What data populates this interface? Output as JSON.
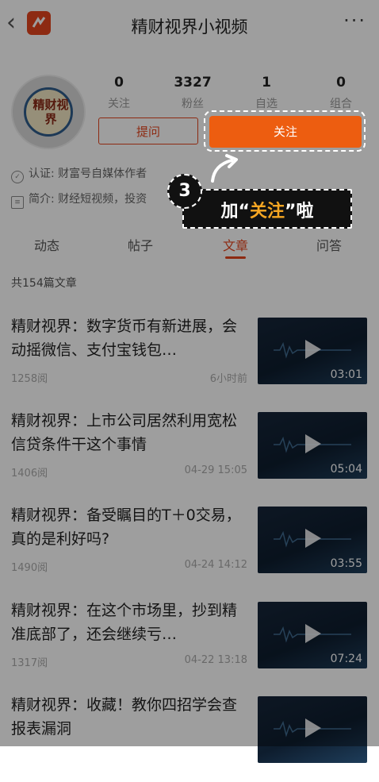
{
  "header": {
    "title": "精财视界小视频",
    "back_icon": "chevron-left-icon",
    "more_icon": "more-icon"
  },
  "profile": {
    "avatar_text": "精财视界",
    "stats": [
      {
        "value": "0",
        "label": "关注"
      },
      {
        "value": "3327",
        "label": "粉丝"
      },
      {
        "value": "1",
        "label": "自选"
      },
      {
        "value": "0",
        "label": "组合"
      }
    ],
    "ask_label": "提问",
    "follow_label": "关注",
    "certification": "认证: 财富号自媒体作者",
    "intro": "简介: 财经短视频，投资"
  },
  "tabs": [
    {
      "label": "动态"
    },
    {
      "label": "帖子"
    },
    {
      "label": "文章",
      "active": true
    },
    {
      "label": "问答"
    }
  ],
  "article_count": "共154篇文章",
  "articles": [
    {
      "title": "精财视界：数字货币有新进展，会动摇微信、支付宝钱包…",
      "reads": "1258阅",
      "time": "6小时前",
      "duration": "03:01"
    },
    {
      "title": "精财视界：上市公司居然利用宽松信贷条件干这个事情",
      "reads": "1406阅",
      "time": "04-29 15:05",
      "duration": "05:04"
    },
    {
      "title": "精财视界：备受瞩目的T＋0交易，真的是利好吗?",
      "reads": "1490阅",
      "time": "04-24 14:12",
      "duration": "03:55"
    },
    {
      "title": "精财视界：在这个市场里，抄到精准底部了，还会继续亏…",
      "reads": "1317阅",
      "time": "04-22 13:18",
      "duration": "07:24"
    },
    {
      "title": "精财视界：收藏！教你四招学会查报表漏洞",
      "reads": "",
      "time": "",
      "duration": ""
    }
  ],
  "tutorial": {
    "step": "3",
    "text_before": "加“",
    "text_highlight": "关注",
    "text_after": "”啦"
  },
  "colors": {
    "accent": "#e4451e",
    "button": "#ed5d10",
    "highlight_text": "#f5a623"
  }
}
